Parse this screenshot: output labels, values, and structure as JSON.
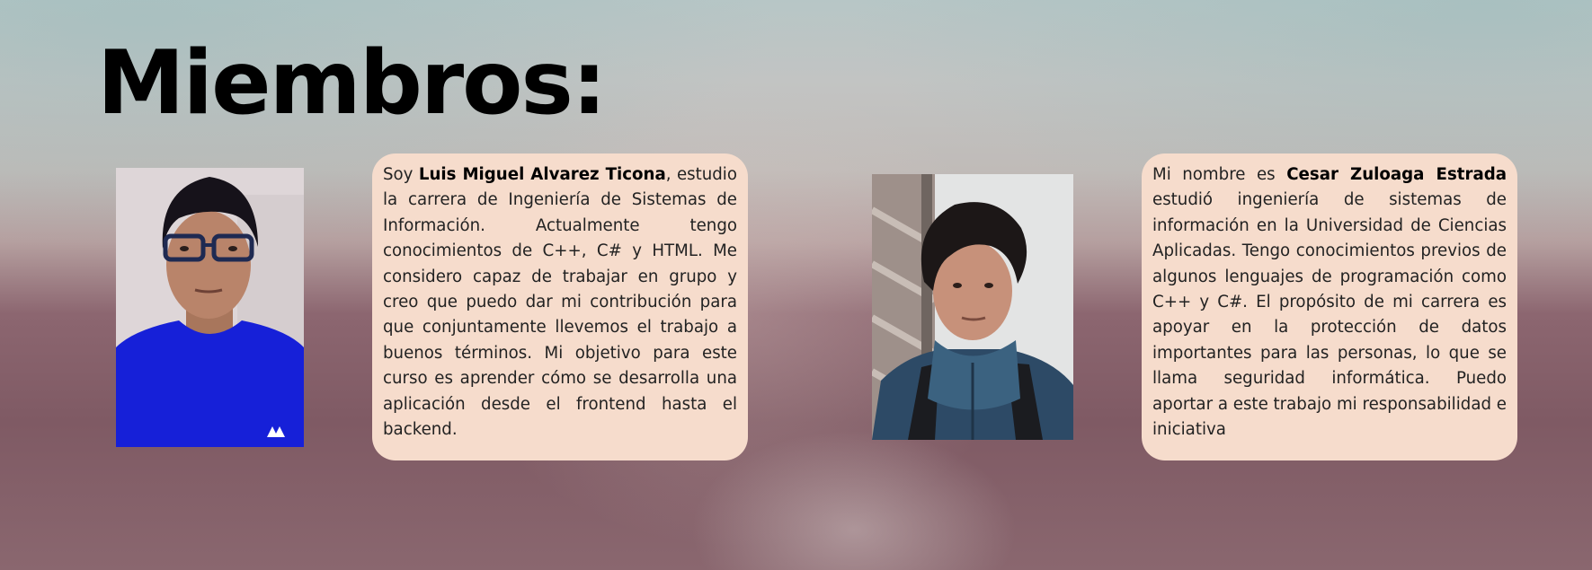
{
  "page": {
    "title": "Miembros:"
  },
  "members": [
    {
      "photo_icon": "portrait-photo-glasses-blue-shirt",
      "bio_prefix": "Soy ",
      "name": "Luis Miguel Alvarez Ticona",
      "bio_suffix": ", estudio la carrera de Ingeniería de Sistemas de Información. Actualmente tengo conocimientos de C++, C# y HTML. Me considero capaz de trabajar en grupo y creo que puedo dar mi contribución para que conjuntamente llevemos el trabajo a buenos términos. Mi objetivo para este curso es aprender cómo se desarrolla una aplicación desde el frontend hasta el backend."
    },
    {
      "photo_icon": "portrait-photo-scarf-backpack",
      "bio_prefix": "Mi nombre es ",
      "name": "Cesar Zuloaga Estrada",
      "bio_suffix": " estudió ingeniería de sistemas de información en la Universidad de Ciencias Aplicadas. Tengo conocimientos previos de algunos lenguajes de programación como C++ y C#. El propósito de mi carrera es apoyar en la protección de datos importantes para las personas, lo que se llama seguridad informática. Puedo aportar a este trabajo mi responsabilidad e iniciativa"
    }
  ],
  "colors": {
    "card_background": "#f6dccc",
    "title_text": "#000000",
    "body_text": "#222222"
  }
}
